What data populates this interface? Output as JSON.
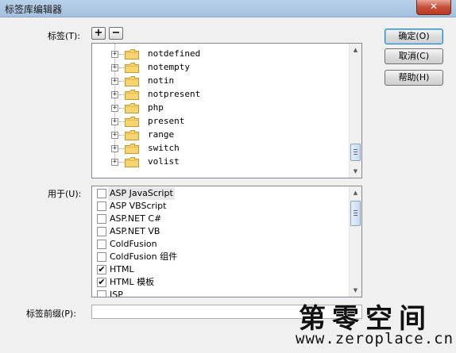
{
  "window": {
    "title": "标签库编辑器",
    "close_glyph": "✕"
  },
  "tags": {
    "label": "标签(T):",
    "add_glyph": "+",
    "remove_glyph": "−",
    "expander_glyph": "+",
    "items": [
      "notdefined",
      "notempty",
      "notin",
      "notpresent",
      "php",
      "present",
      "range",
      "switch",
      "volist"
    ]
  },
  "used_in": {
    "label": "用于(U):",
    "items": [
      {
        "label": "ASP JavaScript",
        "checked": false,
        "selected": true
      },
      {
        "label": "ASP VBScript",
        "checked": false
      },
      {
        "label": "ASP.NET C#",
        "checked": false
      },
      {
        "label": "ASP.NET VB",
        "checked": false
      },
      {
        "label": "ColdFusion",
        "checked": false
      },
      {
        "label": "ColdFusion 组件",
        "checked": false
      },
      {
        "label": "HTML",
        "checked": true
      },
      {
        "label": "HTML 模板",
        "checked": true
      },
      {
        "label": "JSP",
        "checked": false
      }
    ]
  },
  "prefix": {
    "label": "标签前缀(P):",
    "value": ""
  },
  "buttons": {
    "ok": "确定(O)",
    "cancel": "取消(C)",
    "help": "帮助(H)"
  },
  "scroll": {
    "up_glyph": "▲",
    "down_glyph": "▼"
  },
  "watermark": {
    "name": "第零空间",
    "url": "www.zeroplace.cn"
  }
}
